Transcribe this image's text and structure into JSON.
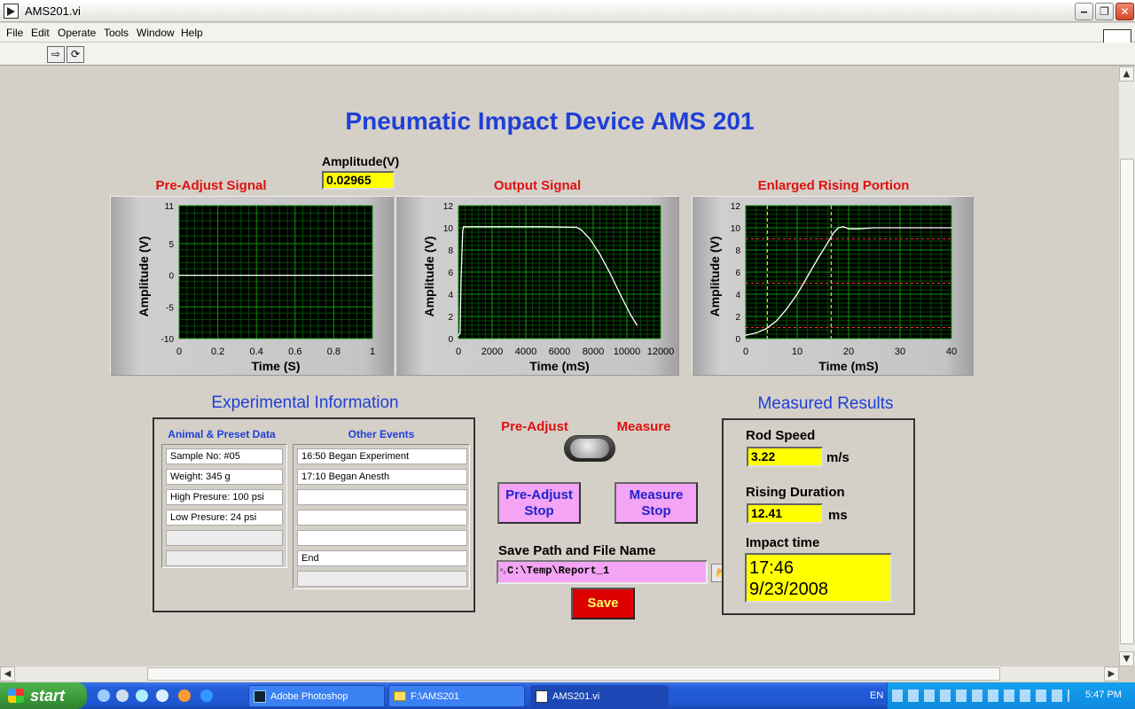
{
  "window": {
    "title": "AMS201.vi",
    "min_glyph": "‒",
    "max_glyph": "❐",
    "close_glyph": "✕"
  },
  "menu": [
    "File",
    "Edit",
    "Operate",
    "Tools",
    "Window",
    "Help"
  ],
  "toolbar": {
    "run_glyph": "⇨",
    "run_cont_glyph": "⟳"
  },
  "vi_icon_label": "1",
  "page_title": "Pneumatic Impact Device AMS 201",
  "amplitude": {
    "label": "Amplitude(V)",
    "value": "0.02965"
  },
  "graphs": [
    {
      "title": "Pre-Adjust  Signal",
      "ylabel": "Amplitude (V)",
      "xlabel": "Time (S)",
      "yticks": [
        "11",
        "5",
        "0",
        "-5",
        "-10"
      ],
      "xticks": [
        "0",
        "0.2",
        "0.4",
        "0.6",
        "0.8",
        "1"
      ]
    },
    {
      "title": "Output  Signal",
      "ylabel": "Amplitude (V)",
      "xlabel": "Time (mS)",
      "yticks": [
        "12",
        "10",
        "8",
        "6",
        "4",
        "2",
        "0"
      ],
      "xticks": [
        "0",
        "2000",
        "4000",
        "6000",
        "8000",
        "10000",
        "12000"
      ]
    },
    {
      "title": "Enlarged Rising Portion",
      "ylabel": "Amplitude (V)",
      "xlabel": "Time (mS)",
      "yticks": [
        "12",
        "10",
        "8",
        "6",
        "4",
        "2",
        "0"
      ],
      "xticks": [
        "0",
        "10",
        "20",
        "30",
        "40"
      ]
    }
  ],
  "chart_data": [
    {
      "type": "line",
      "title": "Pre-Adjust  Signal",
      "xlabel": "Time (S)",
      "ylabel": "Amplitude (V)",
      "xlim": [
        0,
        1
      ],
      "ylim": [
        -10,
        11
      ],
      "grid": true,
      "x": [
        0,
        0.2,
        0.4,
        0.6,
        0.8,
        1
      ],
      "y": [
        0,
        0,
        0,
        0,
        0,
        0
      ]
    },
    {
      "type": "line",
      "title": "Output  Signal",
      "xlabel": "Time (mS)",
      "ylabel": "Amplitude (V)",
      "xlim": [
        0,
        12000
      ],
      "ylim": [
        0,
        12
      ],
      "grid": true,
      "x": [
        0,
        100,
        150,
        250,
        300,
        1000,
        3000,
        5000,
        7000,
        7300,
        7800,
        8400,
        9000,
        9600,
        10200,
        10600
      ],
      "y": [
        0.3,
        0.5,
        5,
        9.7,
        10.1,
        10.1,
        10.1,
        10.1,
        10.05,
        9.8,
        9.0,
        7.6,
        5.9,
        4.0,
        2.2,
        1.2
      ]
    },
    {
      "type": "line",
      "title": "Enlarged Rising Portion",
      "xlabel": "Time (mS)",
      "ylabel": "Amplitude (V)",
      "xlim": [
        0,
        40
      ],
      "ylim": [
        0,
        12
      ],
      "grid": true,
      "x": [
        0,
        2,
        4,
        6,
        8,
        10,
        12,
        14,
        16,
        17,
        18,
        19,
        20,
        22,
        25,
        30,
        40
      ],
      "y": [
        0.3,
        0.5,
        0.9,
        1.6,
        2.7,
        4.0,
        5.6,
        7.2,
        8.7,
        9.5,
        10.0,
        10.1,
        9.9,
        9.9,
        10.0,
        10.0,
        10.0
      ],
      "cursor_lines_x": [
        4.2,
        16.6
      ],
      "threshold_lines_y": [
        9,
        5,
        1
      ]
    }
  ],
  "experimental": {
    "heading": "Experimental  Information",
    "left_head": "Animal & Preset Data",
    "right_head": "Other Events",
    "left_rows": [
      "Sample No: #05",
      "Weight: 345 g",
      "High Presure: 100 psi",
      "Low Presure: 24 psi",
      "",
      ""
    ],
    "right_rows": [
      "16:50 Began Experiment",
      "17:10  Began Anesth",
      "",
      "",
      "",
      "End",
      ""
    ]
  },
  "mode": {
    "left_label": "Pre-Adjust",
    "right_label": "Measure"
  },
  "buttons": {
    "preadjust_stop_l1": "Pre-Adjust",
    "preadjust_stop_l2": "Stop",
    "measure_stop_l1": "Measure",
    "measure_stop_l2": "Stop",
    "save": "Save",
    "folder_glyph": "📂"
  },
  "save_path": {
    "label": "Save Path and File Name",
    "value": "C:\\Temp\\Report_1",
    "prefix_glyph": "⁰₂"
  },
  "results": {
    "heading": "Measured Results",
    "rod_speed_label": "Rod Speed",
    "rod_speed_value": "3.22",
    "rod_speed_unit": "m/s",
    "rising_label": "Rising Duration",
    "rising_value": "12.41",
    "rising_unit": "ms",
    "impact_label": "Impact time",
    "impact_time": "17:46",
    "impact_date": "9/23/2008"
  },
  "scroll": {
    "up": "▲",
    "down": "▼",
    "left": "◀",
    "right": "▶"
  },
  "taskbar": {
    "start": "start",
    "tasks": [
      "Adobe Photoshop",
      "F:\\AMS201",
      "AMS201.vi"
    ],
    "lang": "EN",
    "clock": "5:47 PM"
  },
  "colors": {
    "title_blue": "#1f3fd6",
    "label_red": "#e01010",
    "indicator_yellow": "#ffff00",
    "graph_bg": "#000000",
    "grid_green": "#0a8a0a",
    "button_pink": "#f4a4f4",
    "save_red": "#dd0000"
  }
}
